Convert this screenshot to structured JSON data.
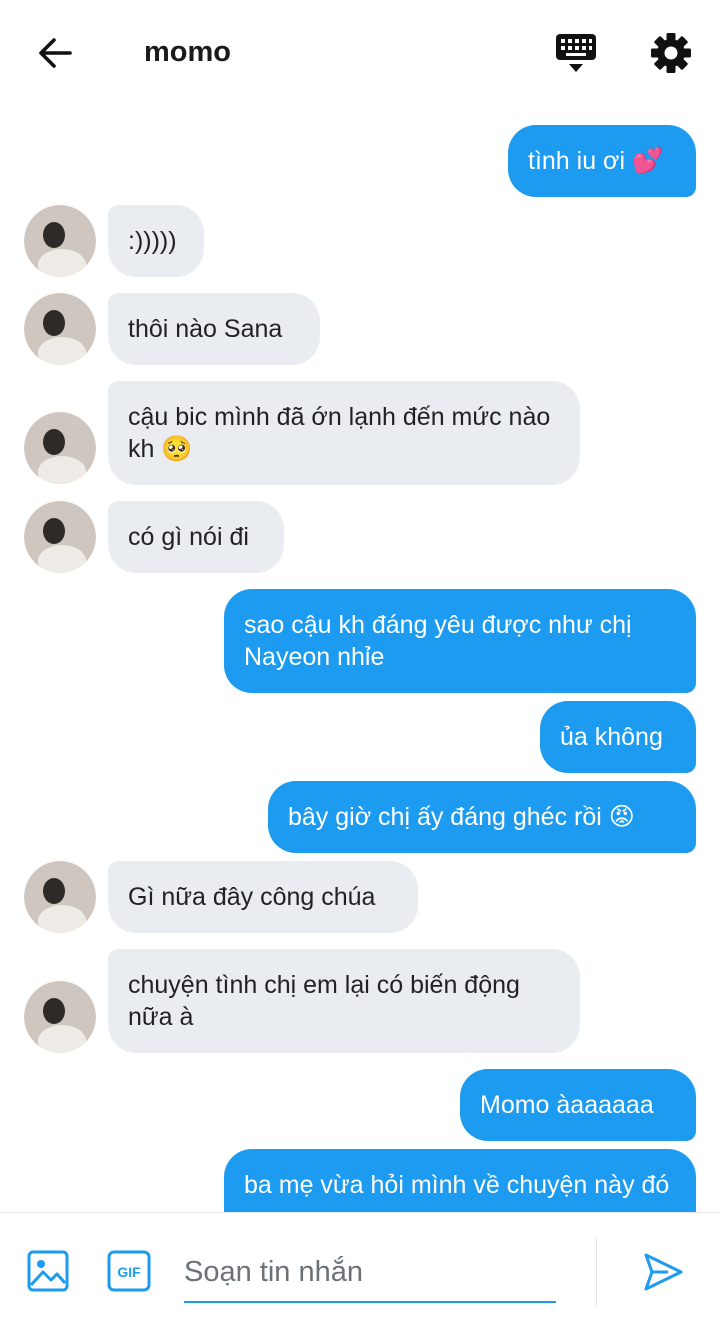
{
  "header": {
    "title": "momo"
  },
  "messages": [
    {
      "from": "me",
      "text": "tình iu ơi 💕"
    },
    {
      "from": "them",
      "text": ":)))))"
    },
    {
      "from": "them",
      "text": "thôi nào Sana"
    },
    {
      "from": "them",
      "text": "cậu bic mình đã ớn lạnh đến mức nào kh 🥺"
    },
    {
      "from": "them",
      "text": "có gì nói đi"
    },
    {
      "from": "me",
      "text": "sao cậu kh đáng yêu được như chị Nayeon nhỉe"
    },
    {
      "from": "me",
      "text": "ủa không"
    },
    {
      "from": "me",
      "text": "bây giờ chị ấy đáng ghéc rồi 😡"
    },
    {
      "from": "them",
      "text": "Gì nữa đây công chúa"
    },
    {
      "from": "them",
      "text": "chuyện tình chị em lại có biến động nữa à"
    },
    {
      "from": "me",
      "text": "Momo àaaaaaa"
    },
    {
      "from": "me",
      "text": "ba mẹ vừa hỏi mình về chuyện này đó"
    }
  ],
  "composer": {
    "placeholder": "Soạn tin nhắn"
  },
  "colors": {
    "accent": "#1d9bf0",
    "incoming_bubble": "#e9edf1"
  }
}
